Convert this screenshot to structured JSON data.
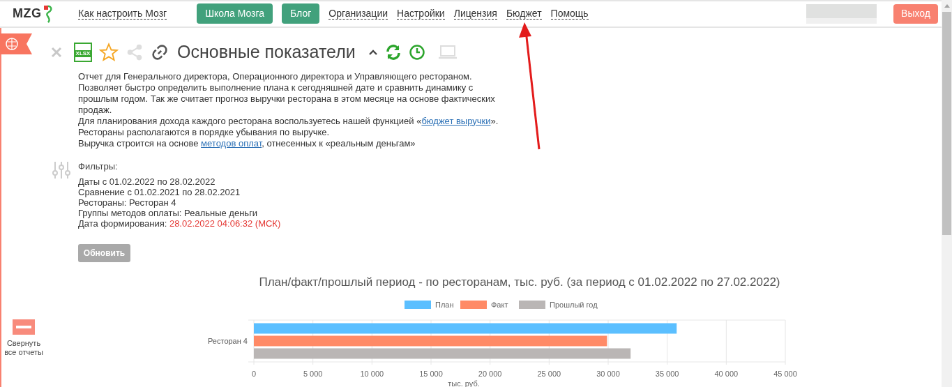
{
  "header": {
    "logo": "MZG",
    "nav": [
      {
        "label": "Как настроить Мозг",
        "kind": "link"
      },
      {
        "label": "Школа Мозга",
        "kind": "button"
      },
      {
        "label": "Блог",
        "kind": "button"
      },
      {
        "label": "Организации",
        "kind": "link"
      },
      {
        "label": "Настройки",
        "kind": "link"
      },
      {
        "label": "Лицензия",
        "kind": "link"
      },
      {
        "label": "Бюджет",
        "kind": "link"
      },
      {
        "label": "Помощь",
        "kind": "link"
      }
    ],
    "logout": "Выход"
  },
  "report": {
    "title": "Основные показатели",
    "toolbar_icon": "XLSX",
    "description": [
      "Отчет для Генерального директора, Операционного директора и Управляющего рестораном.",
      "Позволяет быстро определить выполнение плана к сегодняшней дате и сравнить динамику с",
      "прошлым годом. Так же считает прогноз выручки ресторана в этом месяце на основе фактических",
      "продаж."
    ],
    "budget_line": {
      "before": "Для планирования дохода каждого ресторана воспользуетесь нашей функцией «",
      "link": "бюджет выручки",
      "after": "»."
    },
    "order_line": "Рестораны располагаются в порядке убывания по выручке.",
    "methods_line": {
      "before": "Выручка строится на основе ",
      "link": "методов оплат",
      "after": ", отнесенных к «реальным деньгам»"
    },
    "filters_title": "Фильтры:",
    "filters": [
      {
        "label": "Даты",
        "value": " с 01.02.2022 по 28.02.2022",
        "kind": "plain"
      },
      {
        "label": "Сравнение",
        "value": " с 01.02.2021 по 28.02.2021",
        "kind": "plain"
      },
      {
        "label": "Рестораны:",
        "value": " Ресторан 4",
        "kind": "plain"
      },
      {
        "label": "Группы методов оплаты:",
        "value": " Реальные деньги",
        "kind": "plain"
      },
      {
        "label": "Дата формирования:",
        "value": " 28.02.2022 04:06:32 (МСК)",
        "kind": "alert"
      }
    ],
    "refresh_button": {
      "label": "Обновить",
      "disabled": true
    },
    "chart_data": {
      "type": "bar",
      "orientation": "horizontal",
      "title": "План/факт/прошлый период - по ресторанам, тыс. руб. (за период с 01.02.2022 по 27.02.2022)",
      "xlabel": "тыс. руб.",
      "categories": [
        "Ресторан 4"
      ],
      "series": [
        {
          "name": "План",
          "color": "#5bbfff",
          "values": [
            35800
          ]
        },
        {
          "name": "Факт",
          "color": "#ff8a66",
          "values": [
            29900
          ]
        },
        {
          "name": "Прошлый год",
          "color": "#bab6b5",
          "values": [
            31900
          ]
        }
      ],
      "xlim": [
        0,
        45000
      ],
      "grid": true,
      "legend": true,
      "xticks": [
        {
          "value": 0,
          "label": "0"
        },
        {
          "value": 5000,
          "label": "5 000"
        },
        {
          "value": 10000,
          "label": "10 000"
        },
        {
          "value": 15000,
          "label": "15 000"
        },
        {
          "value": 20000,
          "label": "20 000"
        },
        {
          "value": 25000,
          "label": "25 000"
        },
        {
          "value": 30000,
          "label": "30 000"
        },
        {
          "value": 35000,
          "label": "35 000"
        },
        {
          "value": 40000,
          "label": "40 000"
        },
        {
          "value": 45000,
          "label": "45 000"
        }
      ]
    }
  },
  "sidebar": {
    "collapse_label": "Свернуть все отчеты"
  }
}
